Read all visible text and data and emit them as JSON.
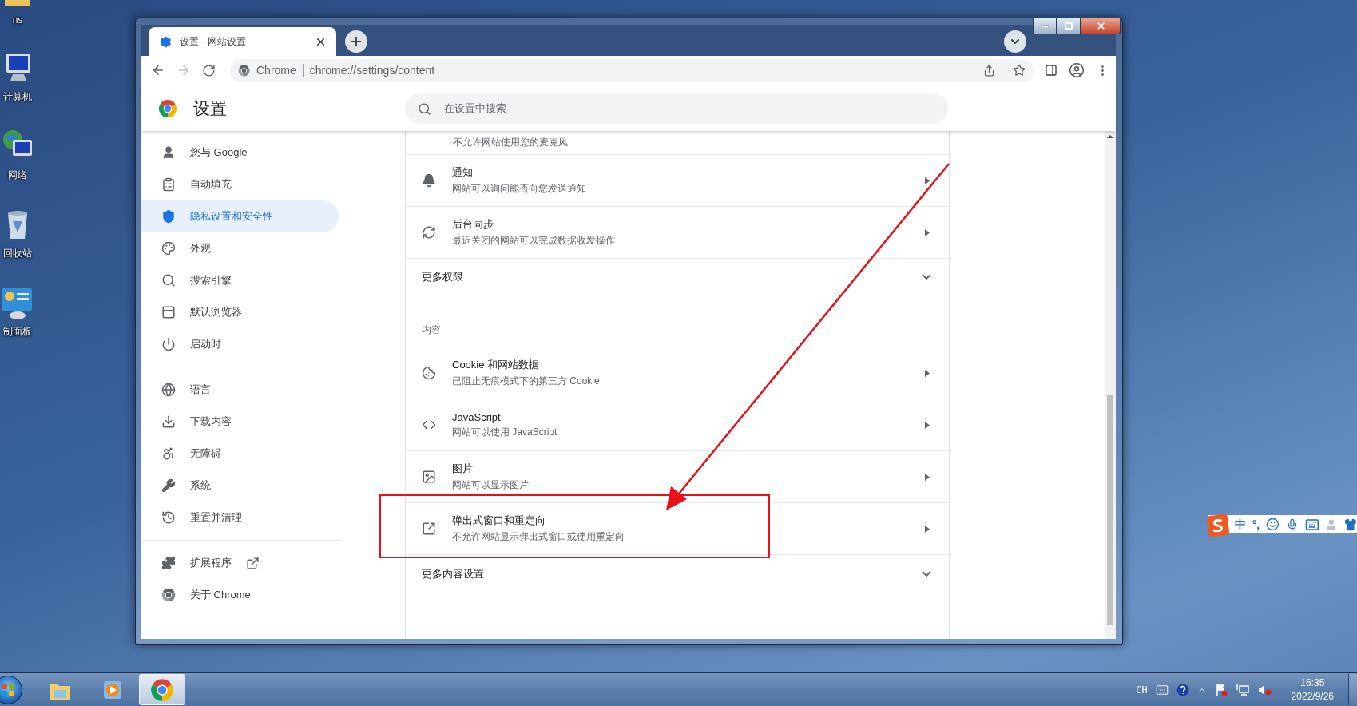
{
  "desktop_icons": [
    {
      "kind": "folder",
      "label": "ns"
    },
    {
      "kind": "computer",
      "label": "计算机"
    },
    {
      "kind": "network",
      "label": "网络"
    },
    {
      "kind": "recycle",
      "label": "回收站"
    },
    {
      "kind": "control",
      "label": "制面板"
    }
  ],
  "browser": {
    "tab": {
      "title": "设置 - 网站设置"
    },
    "toolbar": {
      "back_disabled": false,
      "forward_disabled": true
    },
    "omnibox": {
      "chip": "Chrome",
      "url": "chrome://settings/content"
    }
  },
  "settings": {
    "title": "设置",
    "search": {
      "placeholder": "在设置中搜索"
    },
    "sidebar": {
      "groups": [
        [
          {
            "label": "您与 Google",
            "selected": false
          },
          {
            "label": "自动填充",
            "selected": false
          },
          {
            "label": "隐私设置和安全性",
            "selected": true
          },
          {
            "label": "外观",
            "selected": false
          },
          {
            "label": "搜索引擎",
            "selected": false
          },
          {
            "label": "默认浏览器",
            "selected": false
          },
          {
            "label": "启动时",
            "selected": false
          }
        ],
        [
          {
            "label": "语言",
            "selected": false
          },
          {
            "label": "下载内容",
            "selected": false
          },
          {
            "label": "无障碍",
            "selected": false
          },
          {
            "label": "系统",
            "selected": false
          },
          {
            "label": "重置并清理",
            "selected": false
          }
        ],
        [
          {
            "label": "扩展程序",
            "selected": false,
            "external_link": true
          },
          {
            "label": "关于 Chrome",
            "selected": false
          }
        ]
      ]
    },
    "content": [
      {
        "kind": "partial",
        "subtitle": "不允许网站使用您的麦克风"
      },
      {
        "kind": "link",
        "title": "通知",
        "subtitle": "网站可以询问能否向您发送通知"
      },
      {
        "kind": "link",
        "title": "后台同步",
        "subtitle": "最近关闭的网站可以完成数据收发操作"
      },
      {
        "kind": "expander",
        "title": "更多权限",
        "expanded": false
      },
      {
        "kind": "section",
        "title": "内容"
      },
      {
        "kind": "link",
        "title": "Cookie 和网站数据",
        "subtitle": "已阻止无痕模式下的第三方 Cookie"
      },
      {
        "kind": "link",
        "title": "JavaScript",
        "subtitle": "网站可以使用 JavaScript"
      },
      {
        "kind": "link",
        "title": "图片",
        "subtitle": "网站可以显示图片"
      },
      {
        "kind": "link",
        "title": "弹出式窗口和重定向",
        "subtitle": "不允许网站显示弹出式窗口或使用重定向"
      },
      {
        "kind": "expander",
        "title": "更多内容设置",
        "expanded": false
      }
    ]
  },
  "ime_bar": {
    "mode": "中",
    "punctuation": "°,"
  },
  "taskbar": {
    "apps": [
      {
        "kind": "explorer",
        "selected": false
      },
      {
        "kind": "media",
        "selected": false
      },
      {
        "kind": "chrome",
        "selected": true
      }
    ],
    "language": "CH",
    "time": "16:35",
    "date": "2022/9/26"
  }
}
